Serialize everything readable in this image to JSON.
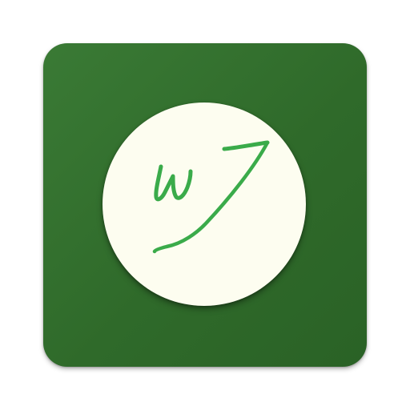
{
  "app_icon": {
    "tile_color": "#2f6a2a",
    "badge_color": "#fdfdf0",
    "logo_color": "#3aab4a",
    "logo_text": "wJ",
    "icon": "signature-monogram-icon"
  }
}
